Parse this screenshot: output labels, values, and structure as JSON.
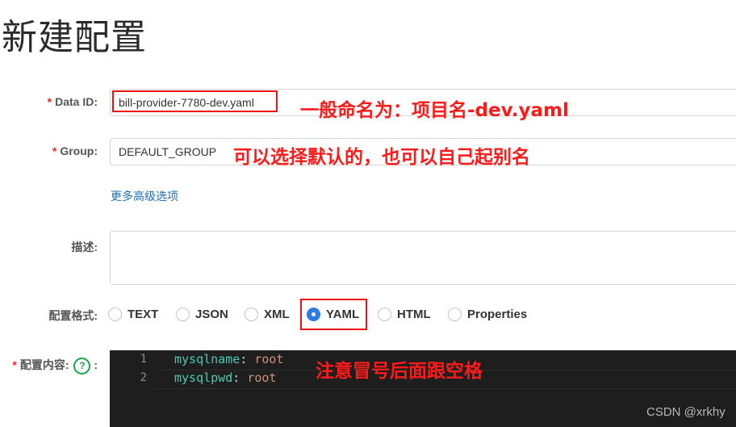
{
  "page_title": "新建配置",
  "required_mark": "*",
  "data_id": {
    "label": "Data ID:",
    "value": "bill-provider-7780-dev.yaml",
    "annotation": "一般命名为：项目名-dev.yaml"
  },
  "group": {
    "label": "Group:",
    "value": "DEFAULT_GROUP",
    "annotation": "可以选择默认的，也可以自己起别名"
  },
  "advanced_link": "更多高级选项",
  "description": {
    "label": "描述:",
    "value": ""
  },
  "format": {
    "label": "配置格式:",
    "options": [
      "TEXT",
      "JSON",
      "XML",
      "YAML",
      "HTML",
      "Properties"
    ],
    "selected": "YAML"
  },
  "content": {
    "label": "配置内容:",
    "help_icon": "?",
    "help_suffix": ":",
    "annotation": "注意冒号后面跟空格",
    "lines": [
      {
        "number": "1",
        "key": "mysqlname",
        "sep": ": ",
        "value": "root"
      },
      {
        "number": "2",
        "key": "mysqlpwd",
        "sep": ": ",
        "value": "root"
      }
    ]
  },
  "watermark": "CSDN @xrkhy",
  "colors": {
    "annotation_red": "#ff1a1a",
    "link_blue": "#1f6fb8",
    "radio_selected": "#2d7be4",
    "editor_bg": "#1e1e1e",
    "help_green": "#1aa34a"
  }
}
